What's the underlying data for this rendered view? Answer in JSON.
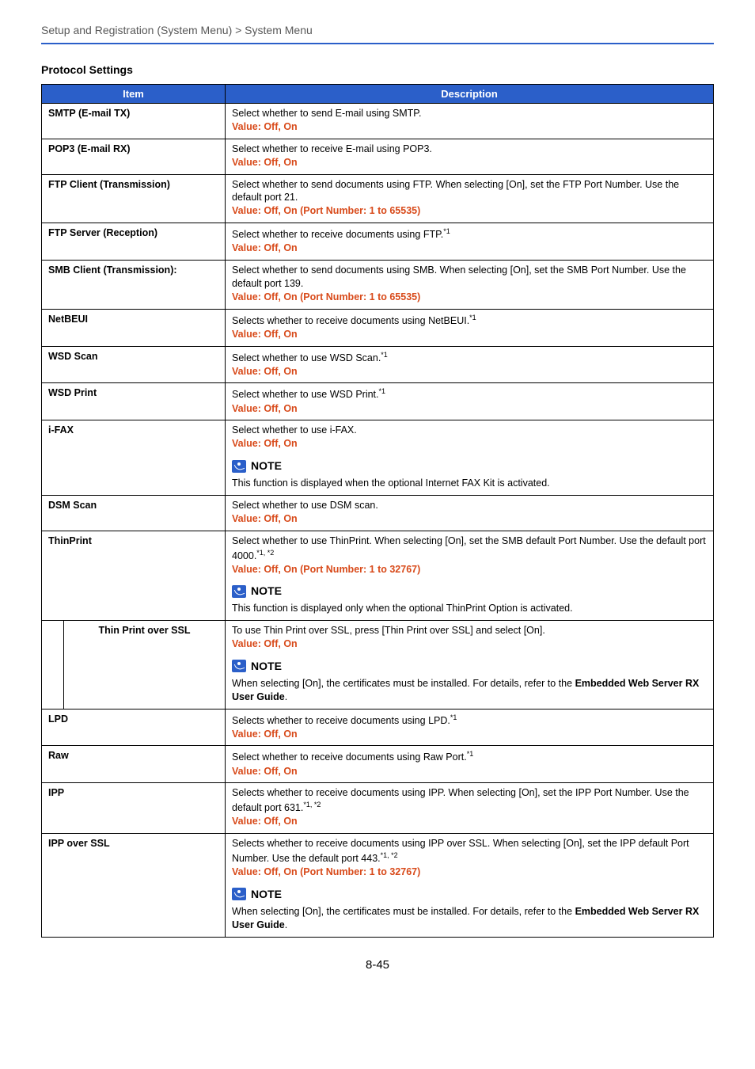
{
  "breadcrumb": "Setup and Registration (System Menu) > System Menu",
  "section_heading": "Protocol Settings",
  "headers": {
    "item": "Item",
    "description": "Description"
  },
  "value_label": "Value",
  "note_label": "NOTE",
  "rows": {
    "smtp": {
      "item": "SMTP (E-mail TX)",
      "desc": "Select whether to send E-mail using SMTP.",
      "value": ": Off, On"
    },
    "pop3": {
      "item": "POP3 (E-mail RX)",
      "desc": "Select whether to receive E-mail using POP3.",
      "value": ": Off, On"
    },
    "ftp_client": {
      "item": "FTP Client (Transmission)",
      "desc": "Select whether to send documents using FTP. When selecting [On], set the FTP Port Number. Use the default port 21.",
      "value": ": Off, On (Port Number: 1 to 65535)"
    },
    "ftp_server": {
      "item": "FTP Server (Reception)",
      "desc_pre": "Select whether to receive documents using FTP.",
      "sup": "*1",
      "value": ": Off, On"
    },
    "smb_client": {
      "item": "SMB Client (Transmission):",
      "desc": "Select whether to send documents using SMB. When selecting [On], set the SMB Port Number. Use the default port 139.",
      "value": ": Off, On (Port Number: 1 to 65535)"
    },
    "netbeui": {
      "item": "NetBEUI",
      "desc_pre": "Selects whether to receive documents using NetBEUI.",
      "sup": "*1",
      "value": ": Off, On"
    },
    "wsd_scan": {
      "item": "WSD Scan",
      "desc_pre": "Select whether to use WSD Scan.",
      "sup": "*1",
      "value": ": Off, On"
    },
    "wsd_print": {
      "item": "WSD Print",
      "desc_pre": "Select whether to use WSD Print.",
      "sup": "*1",
      "value": ": Off, On"
    },
    "ifax": {
      "item": "i-FAX",
      "desc": "Select whether to use i-FAX.",
      "value": ": Off, On",
      "note": "This function is displayed when the optional Internet FAX Kit is activated."
    },
    "dsm": {
      "item": "DSM Scan",
      "desc": "Select whether to use DSM scan.",
      "value": ": Off, On"
    },
    "thinprint": {
      "item": "ThinPrint",
      "desc_pre": "Select whether to use ThinPrint. When selecting [On], set the SMB default Port Number. Use the default port 4000.",
      "sup": "*1, *2",
      "value": ": Off, On (Port Number: 1 to 32767)",
      "note": "This function is displayed only when the optional ThinPrint Option is activated."
    },
    "thinprint_ssl": {
      "item": "Thin Print over SSL",
      "desc": "To use Thin Print over SSL, press [Thin Print over SSL] and select [On].",
      "value": ": Off, On",
      "note_pre": "When selecting [On], the certificates must be installed. For details, refer to the ",
      "note_bold": "Embedded Web Server RX User Guide",
      "note_post": "."
    },
    "lpd": {
      "item": "LPD",
      "desc_pre": "Selects whether to receive documents using LPD.",
      "sup": "*1",
      "value": ": Off, On"
    },
    "raw": {
      "item": "Raw",
      "desc_pre": "Select whether to receive documents using Raw Port.",
      "sup": "*1",
      "value": ": Off, On"
    },
    "ipp": {
      "item": "IPP",
      "desc_pre": "Selects whether to receive documents using IPP. When selecting [On], set the IPP Port Number. Use the default port 631.",
      "sup": "*1, *2",
      "value": ": Off, On"
    },
    "ipp_ssl": {
      "item": "IPP over SSL",
      "desc_pre": "Selects whether to receive documents using IPP over SSL. When selecting [On], set the IPP default Port Number. Use the default port 443.",
      "sup": "*1, *2",
      "value": ": Off, On (Port Number: 1 to 32767)",
      "note_pre": "When selecting [On], the certificates must be installed. For details, refer to the ",
      "note_bold": "Embedded Web Server RX User Guide",
      "note_post": "."
    }
  },
  "page_number": "8-45"
}
